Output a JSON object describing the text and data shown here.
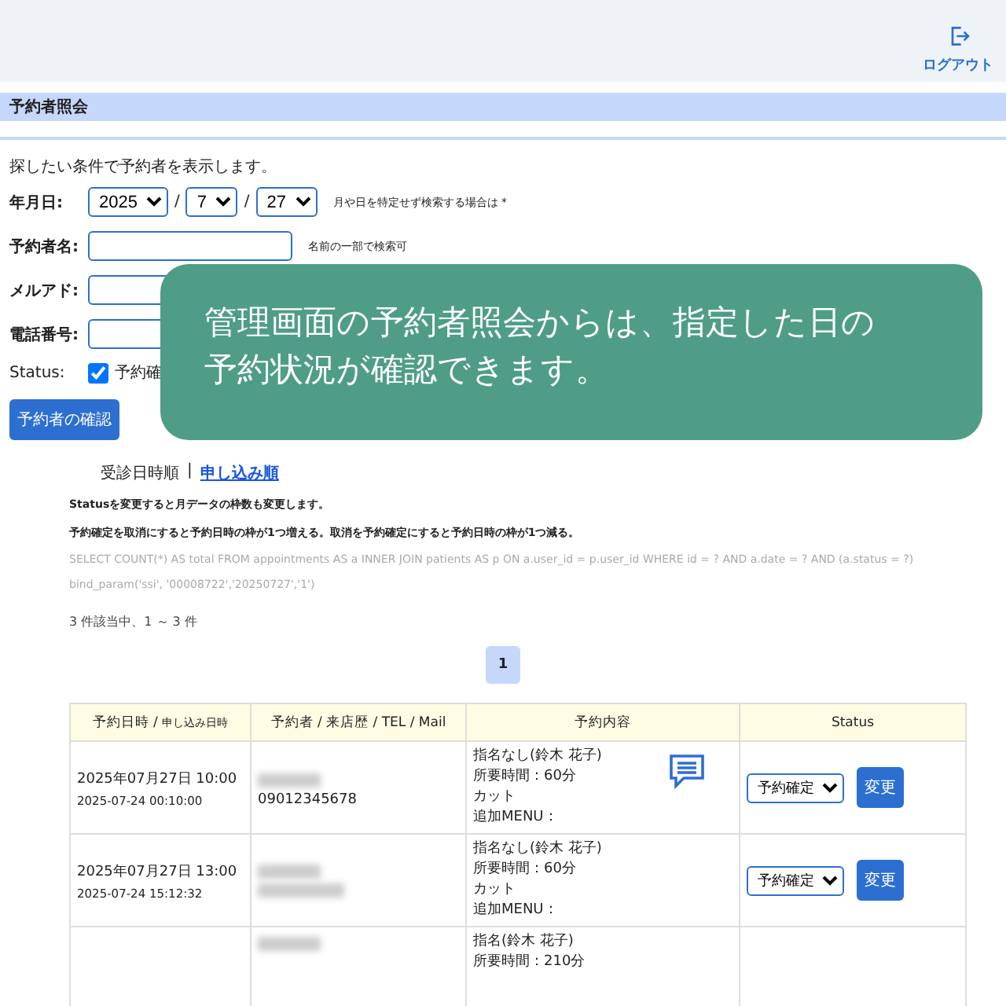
{
  "header": {
    "logout_label": "ログアウト"
  },
  "page_title": "予約者照会",
  "intro": "探したい条件で予約者を表示します。",
  "search": {
    "date_label": "年月日:",
    "year": "2025",
    "separator_1": "/",
    "month": "7",
    "separator_2": "/",
    "day": "27",
    "date_note": "月や日を特定せず検索する場合は *",
    "name_label": "予約者名:",
    "name_note": "名前の一部で検索可",
    "email_label": "メルアド:",
    "phone_label": "電話番号:",
    "status_label": "Status:",
    "status_option": {
      "label": "予約確",
      "checked": true
    },
    "submit": "予約者の確認"
  },
  "callout": "管理画面の予約者照会からは、指定した日の予約状況が確認できます。",
  "sort": {
    "options": [
      {
        "label": "受診日時順",
        "selected": true
      },
      {
        "label": "申し込み順",
        "selected": false
      }
    ],
    "divider": "|"
  },
  "notes": [
    "Statusを変更すると月データの枠数も変更します。",
    "予約確定を取消にすると予約日時の枠が1つ増える。取消を予約確定にすると予約日時の枠が1つ減る。"
  ],
  "debug": [
    "SELECT COUNT(*) AS total FROM appointments AS a INNER JOIN patients AS p ON a.user_id = p.user_id WHERE id = ? AND a.date = ? AND (a.status = ?)",
    "bind_param('ssi', '00008722','20250727','1')"
  ],
  "result_count": "3 件該当中、1 ～ 3 件",
  "pagination": [
    {
      "label": "1",
      "selected": true
    }
  ],
  "table": {
    "columns": [
      {
        "main": "予約日時 / ",
        "sub": "申し込み日時"
      },
      {
        "main": "予約者 / 来店歴 / TEL / Mail"
      },
      {
        "main": "予約内容"
      },
      {
        "main": "Status"
      }
    ],
    "rows": [
      {
        "datetime": "2025年07月27日 10:00",
        "applied": "2025-07-24 00:10:00",
        "contact": [
          {
            "kind": "blurred"
          },
          {
            "kind": "text",
            "text": "09012345678"
          }
        ],
        "content": [
          "指名なし(鈴木 花子)",
          "所要時間：60分",
          "カット",
          "追加MENU："
        ],
        "has_message": true,
        "status": "予約確定",
        "action": "変更"
      },
      {
        "datetime": "2025年07月27日 13:00",
        "applied": "2025-07-24 15:12:32",
        "contact": [
          {
            "kind": "blurred"
          },
          {
            "kind": "blurred"
          }
        ],
        "content": [
          "指名なし(鈴木 花子)",
          "所要時間：60分",
          "カット",
          "追加MENU："
        ],
        "has_message": false,
        "status": "予約確定",
        "action": "変更"
      },
      {
        "content": [
          "指名(鈴木 花子)",
          "所要時間：210分"
        ],
        "has_message": false,
        "contact": [
          {
            "kind": "blurred"
          }
        ]
      }
    ]
  }
}
